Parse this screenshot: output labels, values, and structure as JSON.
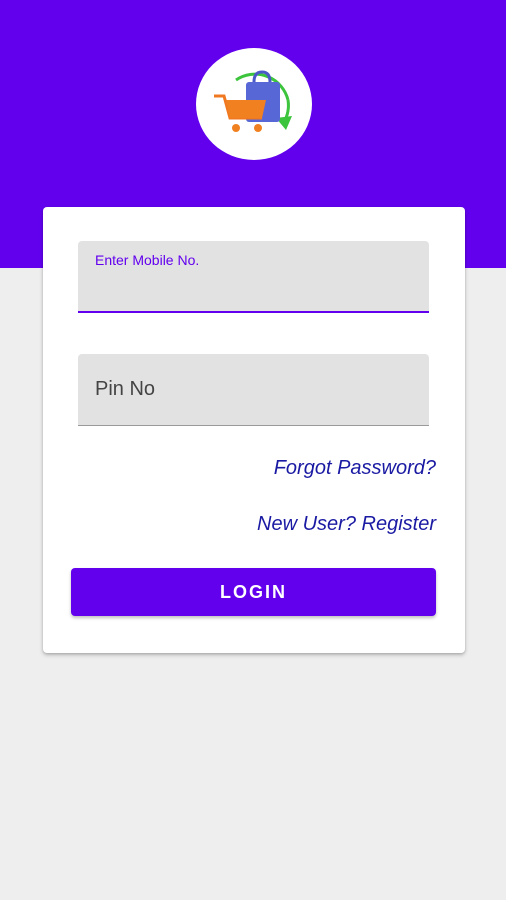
{
  "header": {
    "color": "#6200ee",
    "logo_icon": "shopping-cart-return-logo-icon"
  },
  "form": {
    "mobile_label": "Enter Mobile No.",
    "mobile_value": "",
    "pin_placeholder": "Pin No",
    "pin_value": "",
    "forgot_password": "Forgot Password?",
    "register": "New User? Register",
    "login_button": "LOGIN"
  },
  "colors": {
    "primary": "#6200ee",
    "link": "#1a1aa3",
    "background": "#eeeeee",
    "field_background": "#e2e2e2"
  }
}
